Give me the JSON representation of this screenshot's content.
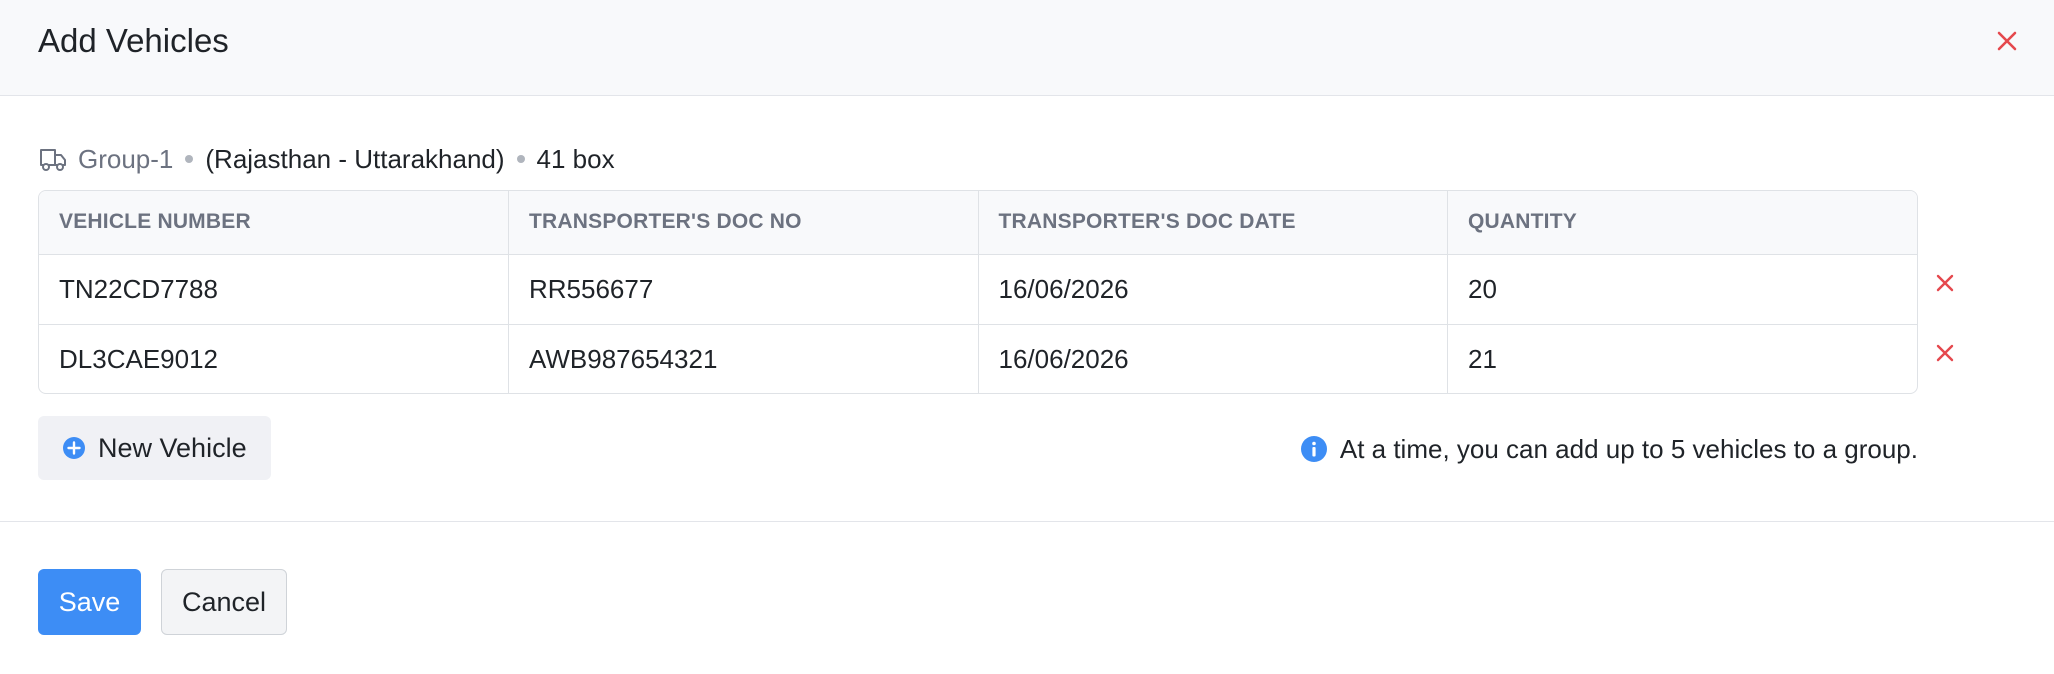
{
  "modal": {
    "title": "Add Vehicles"
  },
  "group": {
    "name": "Group-1",
    "route": "(Rajasthan - Uttarakhand)",
    "boxes": "41 box"
  },
  "table": {
    "columns": [
      "VEHICLE NUMBER",
      "TRANSPORTER'S DOC NO",
      "TRANSPORTER'S DOC DATE",
      "QUANTITY"
    ],
    "rows": [
      {
        "vehicle_number": "TN22CD7788",
        "doc_no": "RR556677",
        "doc_date": "16/06/2026",
        "quantity": "20"
      },
      {
        "vehicle_number": "DL3CAE9012",
        "doc_no": "AWB987654321",
        "doc_date": "16/06/2026",
        "quantity": "21"
      }
    ]
  },
  "actions": {
    "new_vehicle": "New Vehicle",
    "info": "At a time, you can add up to 5 vehicles to a group.",
    "save": "Save",
    "cancel": "Cancel"
  },
  "icons": {
    "close": "close-icon",
    "truck": "truck-icon",
    "remove": "remove-row-icon",
    "plus": "plus-circle-icon",
    "info": "info-icon"
  },
  "colors": {
    "primary": "#3d8df5",
    "danger": "#e5484d",
    "muted": "#6c7280",
    "header_bg": "#f8f9fb"
  }
}
